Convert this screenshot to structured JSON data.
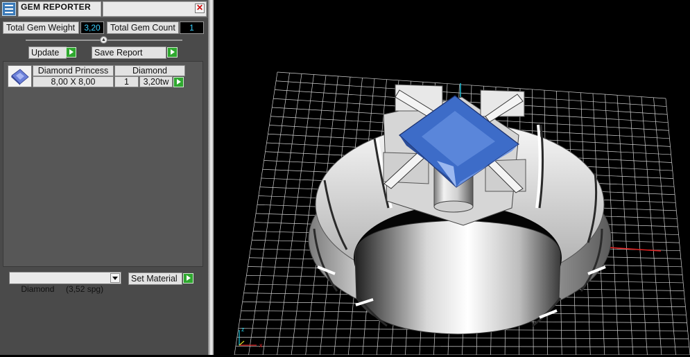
{
  "window": {
    "title": "GEM REPORTER",
    "close_symbol": "✕"
  },
  "totals": {
    "weight_label": "Total Gem Weight",
    "weight_value": "3,20",
    "count_label": "Total Gem Count",
    "count_value": "1"
  },
  "actions": {
    "update_label": "Update",
    "save_label": "Save Report"
  },
  "gem_list": {
    "rows": [
      {
        "name": "Diamond Princess",
        "material": "Diamond",
        "size": "8,00 X 8,00",
        "qty": "1",
        "weight": "3,20tw"
      }
    ]
  },
  "material": {
    "selected": "Diamond     (3,52 spg)",
    "set_label": "Set Material"
  },
  "viewport": {
    "axis_z": "z",
    "axis_x": "x",
    "gem_color": "#3d6cc8",
    "metal_color": "#e6e6e6"
  }
}
